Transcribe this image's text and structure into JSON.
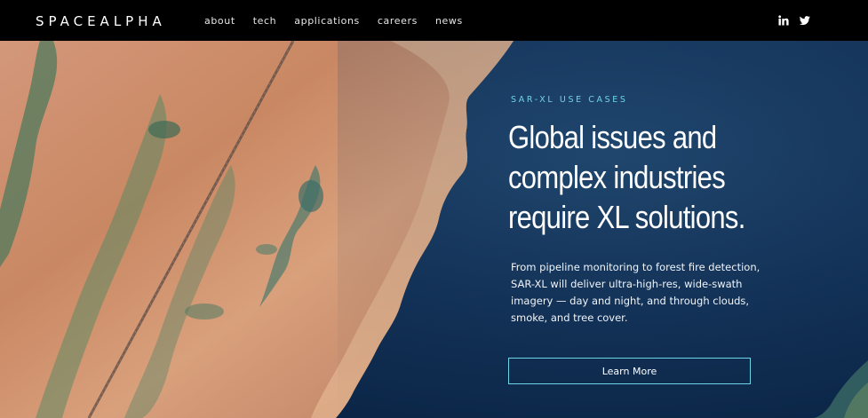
{
  "brand": {
    "logo_text": "SPACEALPHA"
  },
  "nav": {
    "items": [
      {
        "label": "about"
      },
      {
        "label": "tech"
      },
      {
        "label": "applications"
      },
      {
        "label": "careers"
      },
      {
        "label": "news"
      }
    ]
  },
  "social": {
    "icons": [
      "linkedin-icon",
      "twitter-icon"
    ]
  },
  "hero": {
    "eyebrow": "SAR-XL USE CASES",
    "headline": "Global issues and complex industries require XL solutions.",
    "body": "From pipeline monitoring to forest fire detection, SAR-XL will deliver ultra-high-res, wide-swath imagery — day and night, and through clouds, smoke, and tree cover.",
    "cta_label": "Learn More"
  },
  "colors": {
    "topbar_bg": "#000000",
    "accent": "#6fd4e6",
    "ocean": "#143359",
    "land": "#c98a63"
  }
}
